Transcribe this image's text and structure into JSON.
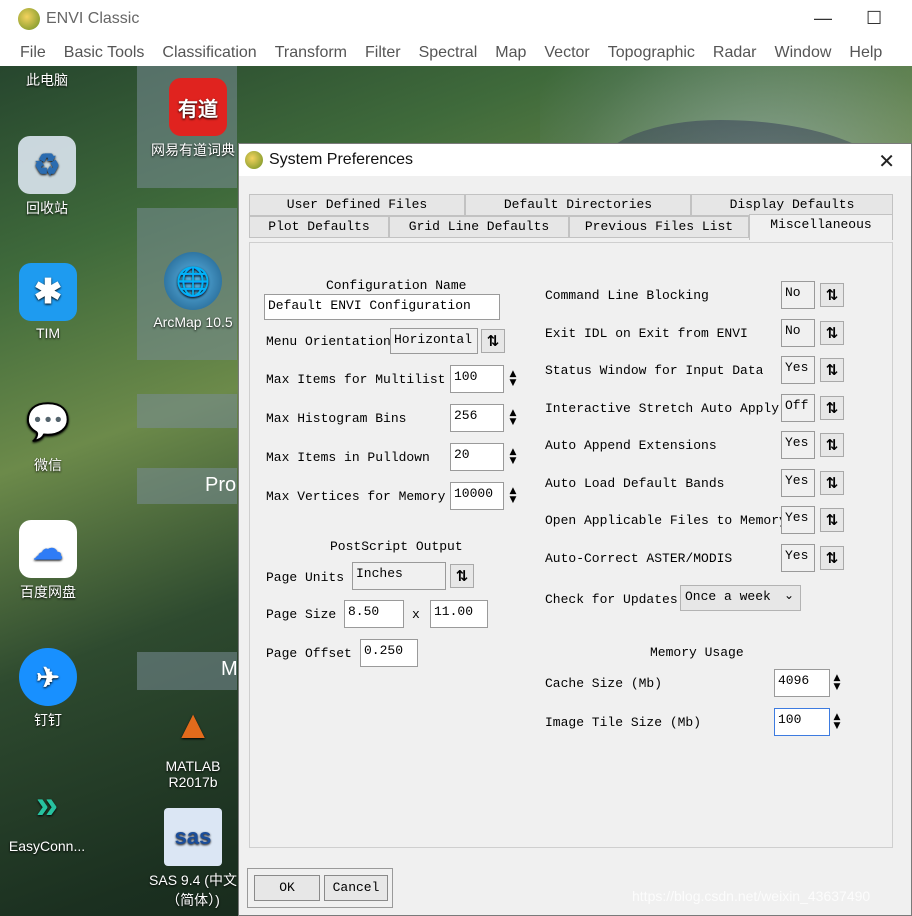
{
  "app": {
    "title": "ENVI Classic",
    "menu": [
      "File",
      "Basic Tools",
      "Classification",
      "Transform",
      "Filter",
      "Spectral",
      "Map",
      "Vector",
      "Topographic",
      "Radar",
      "Window",
      "Help"
    ]
  },
  "desktop": {
    "icons": [
      {
        "label": "此电脑",
        "glyph": ""
      },
      {
        "label": "网易有道词典",
        "glyph": "有道"
      },
      {
        "label": "回收站",
        "glyph": "♻"
      },
      {
        "label": "TIM",
        "glyph": "✱"
      },
      {
        "label": "ArcMap 10.5",
        "glyph": "🌐"
      },
      {
        "label": "微信",
        "glyph": "💬"
      },
      {
        "label": "百度网盘",
        "glyph": "☁"
      },
      {
        "label": "钉钉",
        "glyph": "✈"
      },
      {
        "label": "MATLAB R2017b",
        "glyph": "▲"
      },
      {
        "label": "EasyConn...",
        "glyph": "»"
      },
      {
        "label": "SAS 9.4 (中文（简体）)",
        "glyph": "sas"
      }
    ],
    "partial_texts": [
      "Pro",
      "M"
    ],
    "watermark": "https://blog.csdn.net/weixin_43637490"
  },
  "dialog": {
    "title": "System Preferences",
    "tabs_row1": [
      "User Defined Files",
      "Default Directories",
      "Display Defaults"
    ],
    "tabs_row2": [
      "Plot Defaults",
      "Grid Line Defaults",
      "Previous Files List",
      "Miscellaneous"
    ],
    "active_tab": "Miscellaneous",
    "left": {
      "config_name_label": "Configuration Name",
      "config_name_value": "Default ENVI Configuration",
      "menu_orientation_label": "Menu Orientation",
      "menu_orientation_value": "Horizontal",
      "max_items_multilist_label": "Max Items for Multilist",
      "max_items_multilist_value": "100",
      "max_histogram_bins_label": "Max Histogram Bins",
      "max_histogram_bins_value": "256",
      "max_items_pulldown_label": "Max Items in Pulldown",
      "max_items_pulldown_value": "20",
      "max_vertices_label": "Max Vertices for Memory",
      "max_vertices_value": "10000",
      "postscript_label": "PostScript Output",
      "page_units_label": "Page Units",
      "page_units_value": "Inches",
      "page_size_label": "Page Size",
      "page_size_w": "8.50",
      "page_size_x": "x",
      "page_size_h": "11.00",
      "page_offset_label": "Page Offset",
      "page_offset_value": "0.250"
    },
    "right": {
      "command_line_blocking_label": "Command Line Blocking",
      "command_line_blocking_value": "No",
      "exit_idl_label": "Exit IDL on Exit from ENVI",
      "exit_idl_value": "No",
      "status_window_label": "Status Window for Input Data",
      "status_window_value": "Yes",
      "interactive_stretch_label": "Interactive Stretch Auto Apply",
      "interactive_stretch_value": "Off",
      "auto_append_label": "Auto Append Extensions",
      "auto_append_value": "Yes",
      "auto_load_label": "Auto Load Default Bands",
      "auto_load_value": "Yes",
      "open_applicable_label": "Open Applicable Files to Memory",
      "open_applicable_value": "Yes",
      "auto_correct_label": "Auto-Correct ASTER/MODIS",
      "auto_correct_value": "Yes",
      "check_updates_label": "Check for Updates",
      "check_updates_value": "Once a week",
      "memory_usage_label": "Memory Usage",
      "cache_size_label": "Cache Size (Mb)",
      "cache_size_value": "4096",
      "image_tile_label": "Image Tile Size (Mb)",
      "image_tile_value": "100"
    },
    "ok_label": "OK",
    "cancel_label": "Cancel"
  }
}
